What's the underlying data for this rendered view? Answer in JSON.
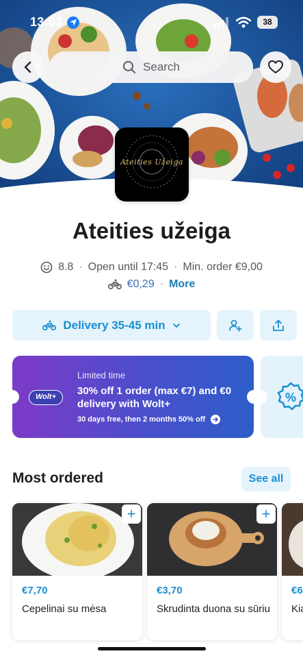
{
  "status_bar": {
    "time": "13:03",
    "battery": "38"
  },
  "header": {
    "search_label": "Search"
  },
  "venue": {
    "logo_text": "Ateities Užeiga",
    "name": "Ateities užeiga",
    "rating": "8.8",
    "open_text": "Open until 17:45",
    "min_order": "Min. order €9,00",
    "delivery_fee": "€0,29",
    "more_label": "More"
  },
  "actions": {
    "delivery_label": "Delivery 35-45 min"
  },
  "promo": {
    "badge": "Wolt+",
    "kicker": "Limited time",
    "title": "30% off 1 order (max €7) and €0 delivery with Wolt+",
    "subtitle": "30 days free, then 2 months 50% off",
    "second_icon": "%"
  },
  "most_ordered": {
    "title": "Most ordered",
    "see_all": "See all",
    "items": [
      {
        "price": "€7,70",
        "name": "Cepelinai su mėsa"
      },
      {
        "price": "€3,70",
        "name": "Skrudinta duona su sūriu"
      },
      {
        "price": "€6",
        "name": "Kia"
      }
    ]
  },
  "colors": {
    "accent": "#1a8fd0",
    "accent_bg": "#e5f4fc",
    "promo_start": "#7d3ac8",
    "promo_end": "#2e5ec8"
  },
  "icons": [
    "location-arrow-icon",
    "signal-icon",
    "wifi-icon",
    "back-chevron-icon",
    "search-icon",
    "heart-icon",
    "smiley-icon",
    "bike-icon",
    "chevron-down-icon",
    "add-person-icon",
    "share-icon",
    "arrow-right-icon",
    "percent-badge-icon",
    "plus-icon"
  ]
}
